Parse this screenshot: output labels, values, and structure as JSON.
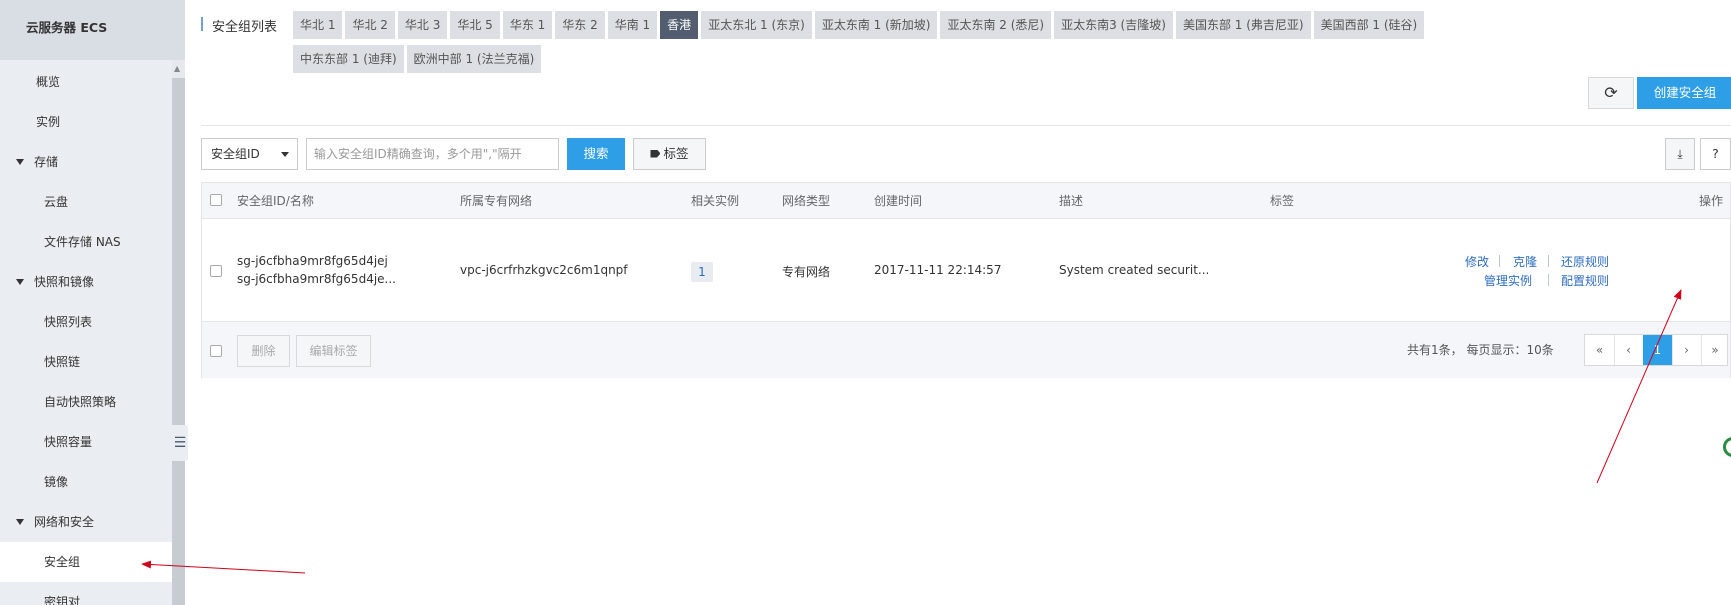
{
  "sidebar": {
    "header": "云服务器 ECS",
    "items": [
      {
        "label": "概览"
      },
      {
        "label": "实例"
      }
    ],
    "groups": [
      {
        "label": "存储",
        "items": [
          {
            "label": "云盘"
          },
          {
            "label": "文件存储 NAS"
          }
        ]
      },
      {
        "label": "快照和镜像",
        "items": [
          {
            "label": "快照列表"
          },
          {
            "label": "快照链"
          },
          {
            "label": "自动快照策略"
          },
          {
            "label": "快照容量"
          },
          {
            "label": "镜像"
          }
        ]
      },
      {
        "label": "网络和安全",
        "items": [
          {
            "label": "安全组"
          },
          {
            "label": "密钥对"
          }
        ]
      }
    ],
    "collapse_glyph": "☰"
  },
  "region_bar": {
    "title": "安全组列表",
    "regions": [
      "华北 1",
      "华北 2",
      "华北 3",
      "华北 5",
      "华东 1",
      "华东 2",
      "华南 1",
      "香港",
      "亚太东北 1 (东京)",
      "亚太东南 1 (新加坡)",
      "亚太东南 2 (悉尼)",
      "亚太东南3 (吉隆坡)",
      "美国东部 1 (弗吉尼亚)",
      "美国西部 1 (硅谷)",
      "中东东部 1 (迪拜)",
      "欧洲中部 1 (法兰克福)"
    ],
    "active_region": "香港"
  },
  "toolbar": {
    "refresh_glyph": "⟳",
    "create_label": "创建安全组",
    "filter_value": "安全组ID",
    "search_placeholder": "输入安全组ID精确查询，多个用\",\"隔开",
    "search_label": "搜索",
    "tag_label": "标签",
    "export_glyph": "⤓",
    "help_label": "?"
  },
  "table": {
    "columns": [
      "安全组ID/名称",
      "所属专有网络",
      "相关实例",
      "网络类型",
      "创建时间",
      "描述",
      "标签",
      "操作"
    ],
    "rows": [
      {
        "id": "sg-j6cfbha9mr8fg65d4jej",
        "name": "sg-j6cfbha9mr8fg65d4je...",
        "vpc": "vpc-j6crfrhzkgvc2c6m1qnpf",
        "instances": "1",
        "network_type": "专有网络",
        "created": "2017-11-11 22:14:57",
        "description": "System created securit...",
        "tags": "",
        "actions": {
          "modify": "修改",
          "clone": "克隆",
          "restore": "还原规则",
          "manage": "管理实例",
          "configure": "配置规则"
        }
      }
    ],
    "footer": {
      "delete_label": "删除",
      "edit_tags_label": "编辑标签",
      "page_info": "共有1条， 每页显示：10条",
      "pager": {
        "first": "«",
        "prev": "‹",
        "current": "1",
        "next": "›",
        "last": "»"
      }
    }
  },
  "colors": {
    "accent": "#2e9ee6",
    "active_region": "#525e6f",
    "link": "#2e6cc0",
    "annotation_arrow": "#d0021b"
  }
}
